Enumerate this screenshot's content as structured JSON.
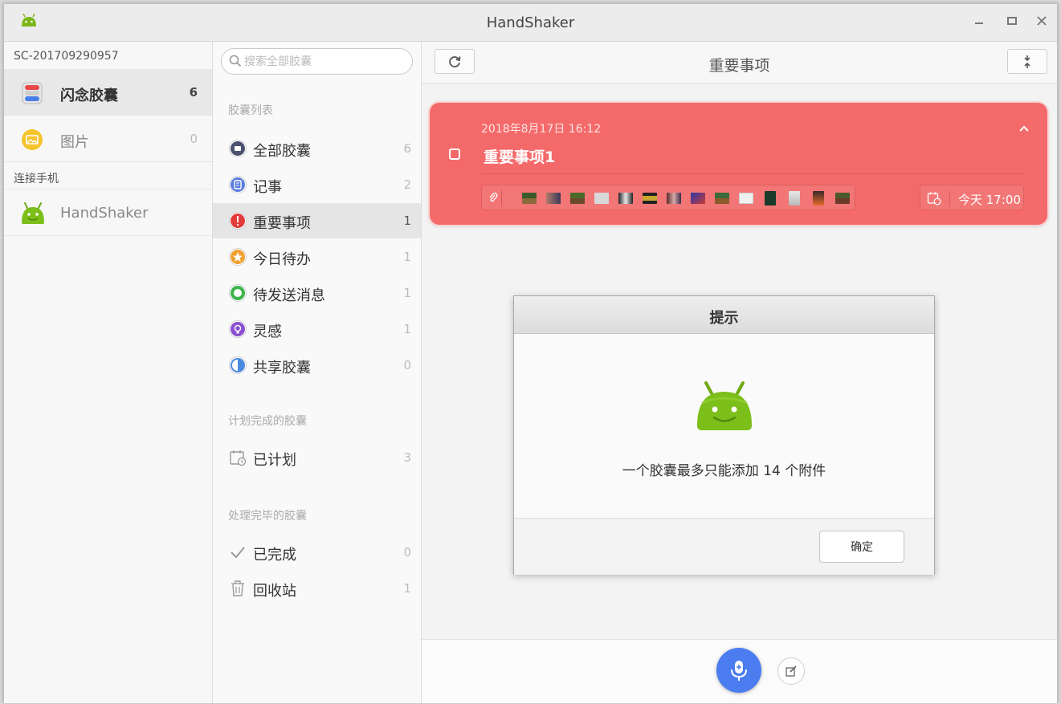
{
  "window": {
    "title": "HandShaker"
  },
  "col1": {
    "device": "SC-201709290957",
    "items": [
      {
        "label": "闪念胶囊",
        "count": "6",
        "icon": "capsule-icon"
      },
      {
        "label": "图片",
        "count": "0",
        "icon": "image-icon"
      }
    ],
    "phone_section": "连接手机",
    "phone": {
      "label": "HandShaker",
      "icon": "android-icon"
    }
  },
  "col2": {
    "search_placeholder": "搜索全部胶囊",
    "group1": "胶囊列表",
    "list": [
      {
        "label": "全部胶囊",
        "count": "6",
        "color": "#4a5270"
      },
      {
        "label": "记事",
        "count": "2",
        "color": "#5a7be0"
      },
      {
        "label": "重要事项",
        "count": "1",
        "color": "#e23b3b"
      },
      {
        "label": "今日待办",
        "count": "1",
        "color": "#f0a030"
      },
      {
        "label": "待发送消息",
        "count": "1",
        "color": "#3cb44a"
      },
      {
        "label": "灵感",
        "count": "1",
        "color": "#8a4fd0"
      },
      {
        "label": "共享胶囊",
        "count": "0",
        "color": "#4a8ae0"
      }
    ],
    "group2": "计划完成的胶囊",
    "planned": {
      "label": "已计划",
      "count": "3"
    },
    "group3": "处理完毕的胶囊",
    "done": [
      {
        "label": "已完成",
        "count": "0"
      },
      {
        "label": "回收站",
        "count": "1"
      }
    ]
  },
  "main": {
    "title": "重要事项",
    "card": {
      "date": "2018年8月17日 16:12",
      "title": "重要事项1",
      "reminder": "今天 17:00",
      "color": "#f46a6a"
    }
  },
  "dialog": {
    "title": "提示",
    "message": "一个胶囊最多只能添加 14 个附件",
    "ok": "确定"
  }
}
